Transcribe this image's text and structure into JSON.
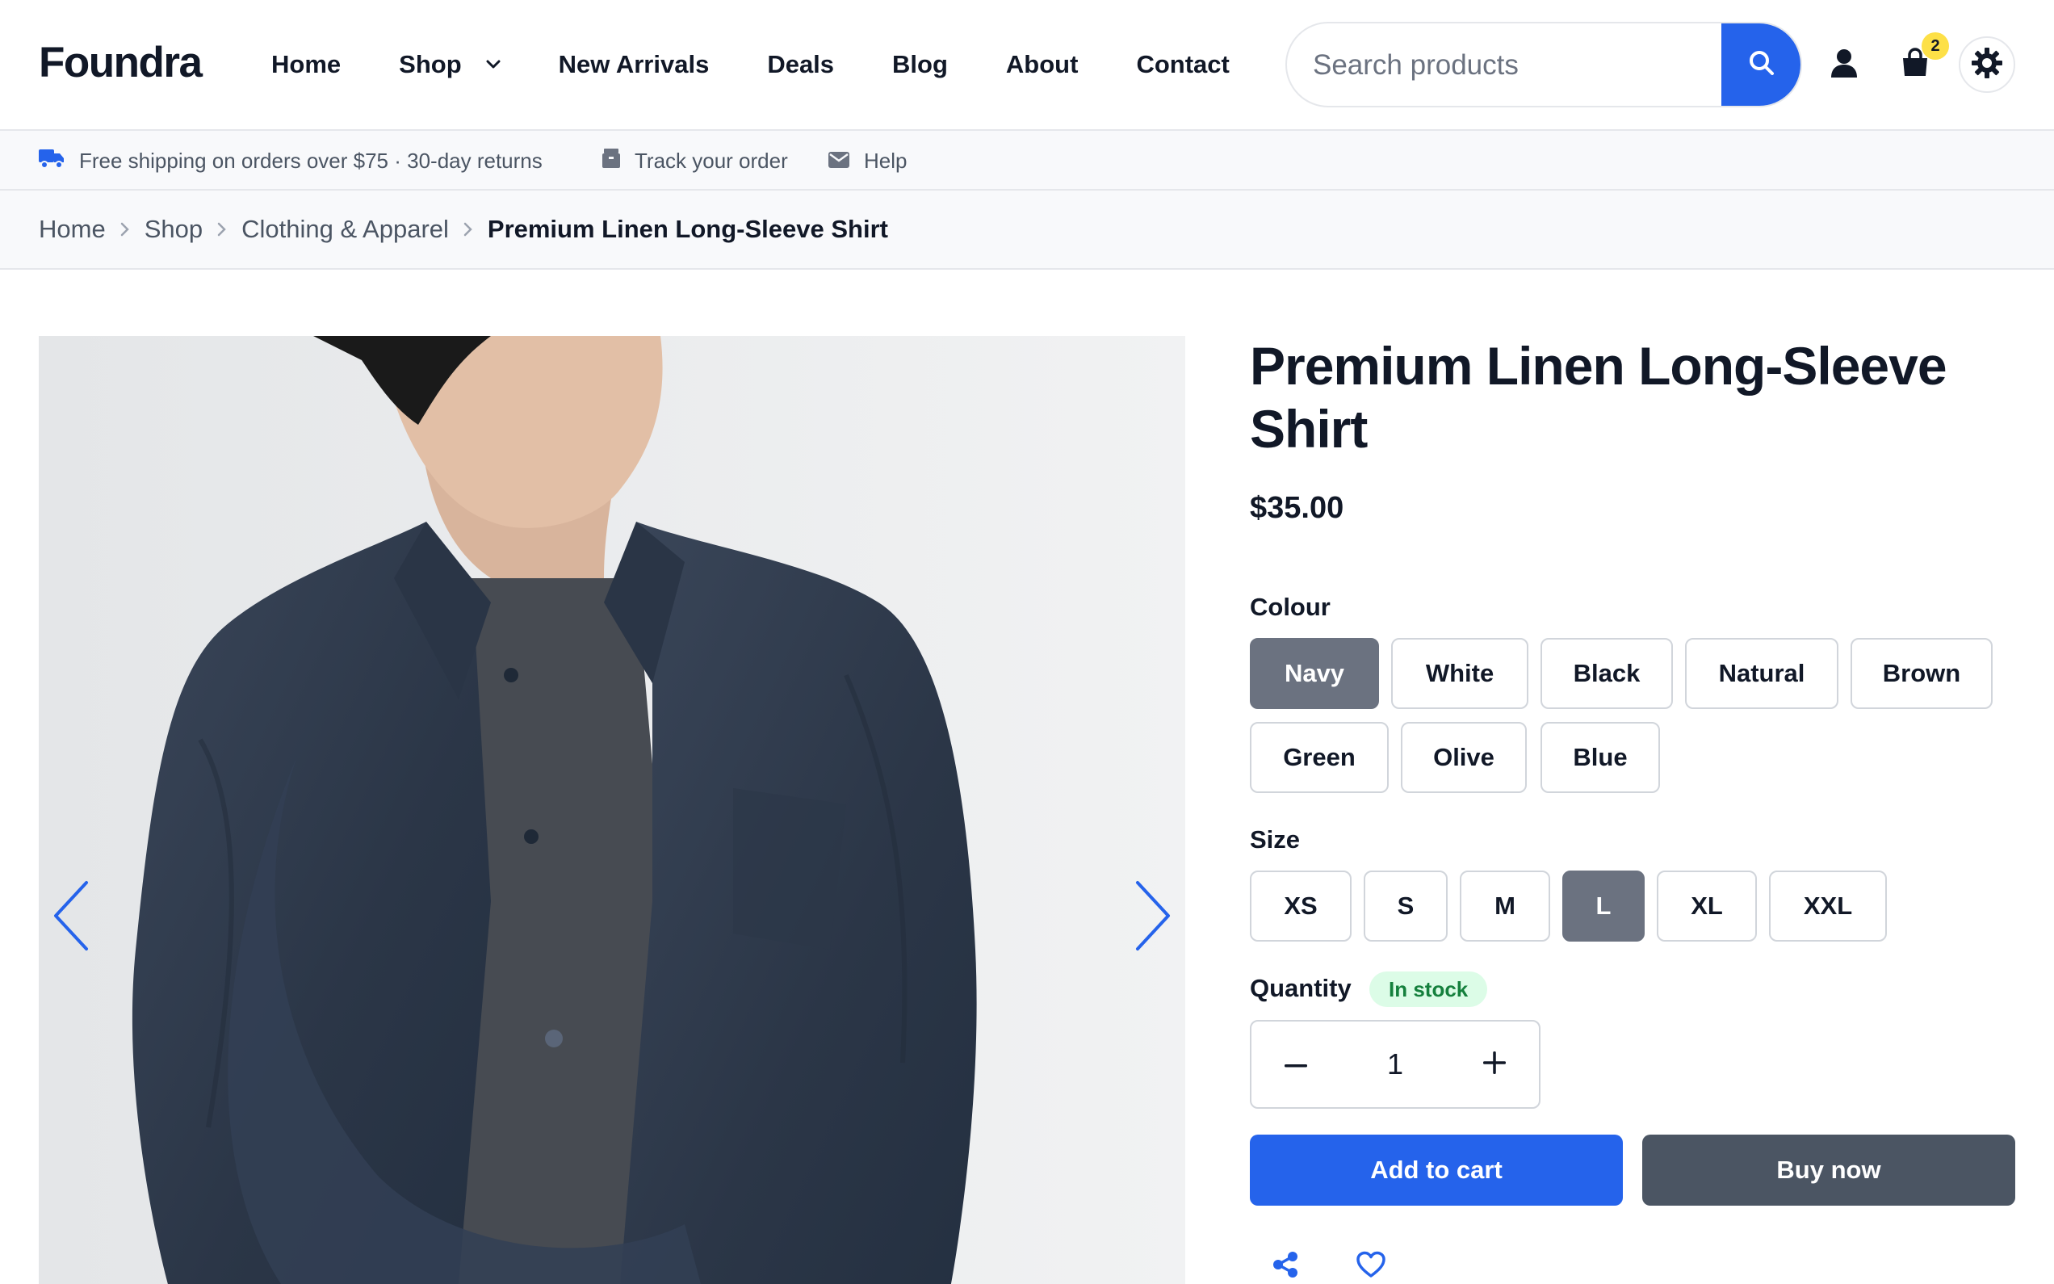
{
  "brand": {
    "name": "Foundra"
  },
  "nav": {
    "items": [
      {
        "label": "Home"
      },
      {
        "label": "Shop",
        "has_dropdown": true
      },
      {
        "label": "New Arrivals"
      },
      {
        "label": "Deals"
      },
      {
        "label": "Blog"
      },
      {
        "label": "About"
      },
      {
        "label": "Contact"
      }
    ]
  },
  "search": {
    "placeholder": "Search products",
    "value": ""
  },
  "header_icons": {
    "account": "user-icon",
    "cart": "shopping-bag-icon",
    "theme": "sun-gear-icon"
  },
  "cart": {
    "count": "2"
  },
  "infobar": {
    "shipping": "Free shipping on orders over $75 · 30-day returns",
    "track": "Track your order",
    "help": "Help"
  },
  "breadcrumb": {
    "items": [
      "Home",
      "Shop",
      "Clothing & Apparel"
    ],
    "current": "Premium Linen Long-Sleeve Shirt"
  },
  "product": {
    "title": "Premium Linen Long-Sleeve Shirt",
    "price": "$35.00",
    "colour_label": "Colour",
    "colours": [
      "Navy",
      "White",
      "Black",
      "Natural",
      "Brown",
      "Green",
      "Olive",
      "Blue"
    ],
    "selected_colour": "Navy",
    "size_label": "Size",
    "sizes": [
      "XS",
      "S",
      "M",
      "L",
      "XL",
      "XXL"
    ],
    "selected_size": "L",
    "quantity_label": "Quantity",
    "stock_status": "In stock",
    "quantity": "1",
    "add_to_cart": "Add to cart",
    "buy_now": "Buy now"
  },
  "colors": {
    "accent": "#2563eb",
    "selected_option": "#6b7280",
    "dark_button": "#4b5563",
    "stock_bg": "#dcfce7",
    "stock_text": "#15803d",
    "badge": "#fde047",
    "shirt": "#2f3b4f"
  }
}
